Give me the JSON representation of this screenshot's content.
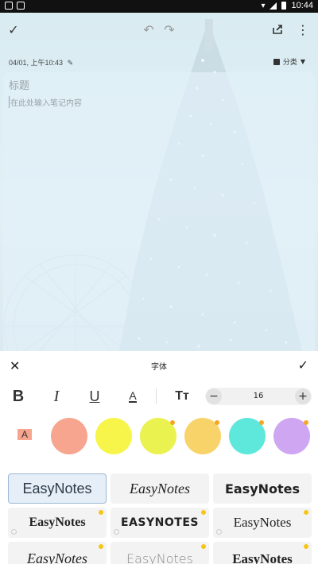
{
  "status_bar": {
    "time": "10:44"
  },
  "note": {
    "date": "04/01, 上午10:43",
    "category_label": "分类",
    "title_placeholder": "标题",
    "content_placeholder": "在此处输入笔记内容"
  },
  "font_panel": {
    "title": "字体",
    "font_size": "16",
    "decrease_label": "−",
    "increase_label": "+",
    "colors": [
      "#f7a58f",
      "#f8f54a",
      "#eaf24f",
      "#f8d36a",
      "#5ee8dc",
      "#cfa6f2"
    ],
    "color_badges": [
      false,
      false,
      true,
      true,
      true,
      true
    ],
    "fonts": [
      {
        "label": "EasyNotes",
        "selected": true,
        "premium": false
      },
      {
        "label": "EasyNotes",
        "selected": false,
        "premium": false
      },
      {
        "label": "EasyNotes",
        "selected": false,
        "premium": false
      },
      {
        "label": "EasyNotes",
        "selected": false,
        "premium": true
      },
      {
        "label": "EASYNOTES",
        "selected": false,
        "premium": true
      },
      {
        "label": "EasyNotes",
        "selected": false,
        "premium": true
      },
      {
        "label": "EasyNotes",
        "selected": false,
        "premium": true
      },
      {
        "label": "EasyNotes",
        "selected": false,
        "premium": true
      },
      {
        "label": "EasyNotes",
        "selected": false,
        "premium": true
      }
    ]
  }
}
